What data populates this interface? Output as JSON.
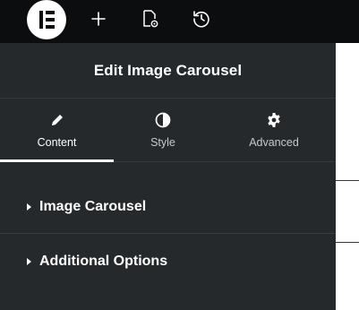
{
  "toolbar": {
    "logo_icon": "elementor-logo-icon",
    "buttons": [
      {
        "icon": "plus-icon"
      },
      {
        "icon": "page-settings-icon"
      },
      {
        "icon": "history-icon"
      }
    ]
  },
  "panel": {
    "title": "Edit Image Carousel",
    "tabs": [
      {
        "label": "Content",
        "icon": "pencil-icon",
        "active": true
      },
      {
        "label": "Style",
        "icon": "half-circle-icon",
        "active": false
      },
      {
        "label": "Advanced",
        "icon": "gear-icon",
        "active": false
      }
    ],
    "sections": [
      {
        "label": "Image Carousel",
        "icon": "caret-right-icon"
      },
      {
        "label": "Additional Options",
        "icon": "caret-right-icon"
      }
    ]
  },
  "colors": {
    "toolbar_bg": "#0c0d0e",
    "panel_bg": "#26292c",
    "text": "#ffffff",
    "muted_text": "#c7c9cc",
    "divider": "#3a3d40"
  }
}
